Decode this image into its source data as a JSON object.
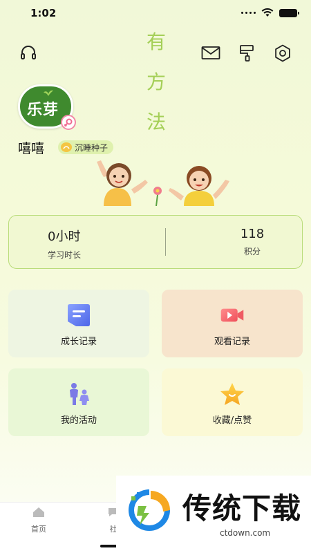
{
  "status_bar": {
    "time": "1:02"
  },
  "header": {
    "slogan_chars": [
      "有",
      "方",
      "法"
    ],
    "icons": [
      "headset-icon",
      "mail-icon",
      "brush-icon",
      "settings-icon"
    ]
  },
  "profile": {
    "avatar_text": "乐芽",
    "username": "嘻嘻",
    "level_label": "沉睡种子"
  },
  "stats": {
    "study_time_value": "0小时",
    "study_time_label": "学习时长",
    "points_value": "118",
    "points_label": "积分"
  },
  "tiles": [
    {
      "label": "成长记录",
      "icon": "document-icon",
      "color": "#eef5e2"
    },
    {
      "label": "观看记录",
      "icon": "video-camera-icon",
      "color": "#f7e4cc"
    },
    {
      "label": "我的活动",
      "icon": "parent-child-icon",
      "color": "#e9f7d6"
    },
    {
      "label": "收藏/点赞",
      "icon": "star-icon",
      "color": "#fbf9d5"
    }
  ],
  "tabbar": {
    "tabs": [
      {
        "label": "首页",
        "icon": "home-icon"
      },
      {
        "label": "社",
        "icon": "community-icon"
      }
    ]
  },
  "watermark": {
    "title": "传统下载",
    "url": "ctdown.com"
  }
}
